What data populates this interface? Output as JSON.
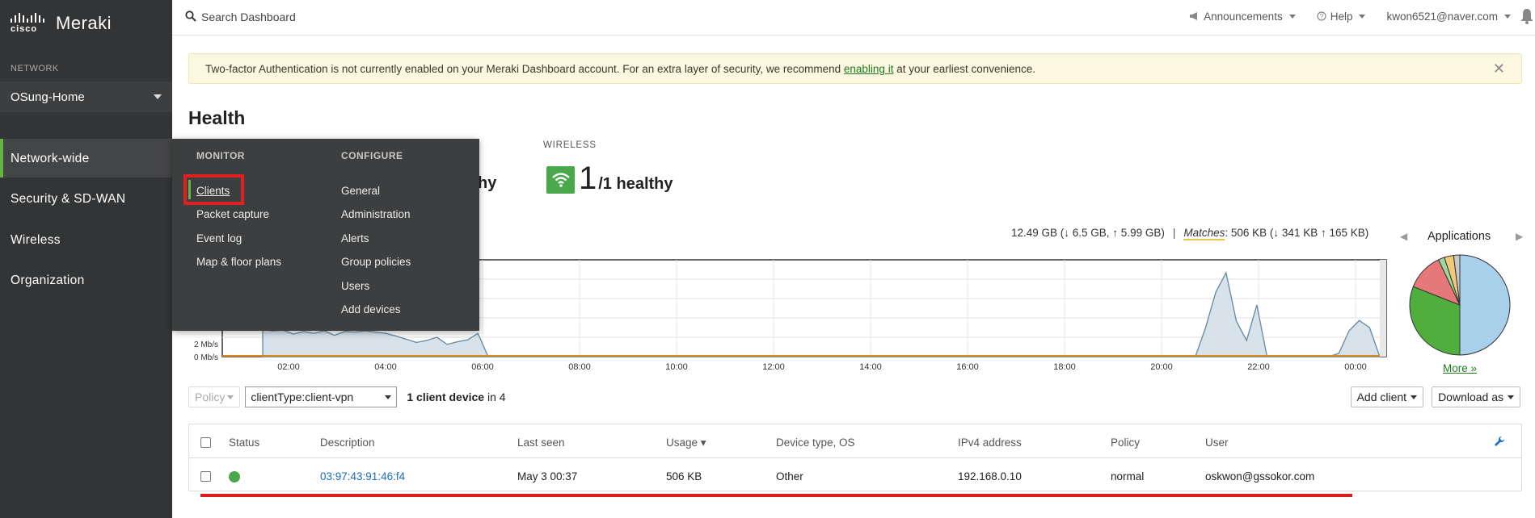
{
  "brand": {
    "cisco": "cisco",
    "meraki": "Meraki"
  },
  "sidebar": {
    "network_label": "NETWORK",
    "network_name": "OSung-Home",
    "items": [
      {
        "label": "Network-wide"
      },
      {
        "label": "Security & SD-WAN"
      },
      {
        "label": "Wireless"
      },
      {
        "label": "Organization"
      }
    ]
  },
  "topbar": {
    "search_placeholder": "Search Dashboard",
    "announcements": "Announcements",
    "help": "Help",
    "user": "kwon6521@naver.com"
  },
  "banner": {
    "text_before": "Two-factor Authentication is not currently enabled on your Meraki Dashboard account. For an extra layer of security, we recommend ",
    "link": "enabling it",
    "text_after": " at your earliest convenience.",
    "close": "✕"
  },
  "health": {
    "title": "Health",
    "wireless_label": "WIRELESS",
    "wireless_count": "1",
    "wireless_rest": "/1 healthy",
    "partial_hidden_text": "hy"
  },
  "usage": {
    "total": "12.49 GB (↓ 6.5 GB, ↑ 5.99 GB)",
    "matches_label": "Matches",
    "matches_value": ": 506 KB  (↓ 341 KB  ↑ 165 KB)"
  },
  "chart_data": {
    "type": "area",
    "x_ticks": [
      "02:00",
      "04:00",
      "06:00",
      "08:00",
      "10:00",
      "12:00",
      "14:00",
      "16:00",
      "18:00",
      "20:00",
      "22:00",
      "00:00"
    ],
    "y_ticks": [
      "0 Mb/s",
      "2 Mb/s"
    ],
    "series": [
      {
        "values": [
          4.2,
          4.0,
          4.1,
          3.5,
          3.9,
          3.6,
          4.0,
          3.3,
          3.9,
          3.8,
          4.0,
          3.8,
          3.6,
          3.2,
          2.7,
          2.2,
          2.5,
          3.0,
          1.9,
          2.3,
          2.6,
          3.6,
          0,
          0,
          0,
          0,
          0,
          0,
          0,
          0,
          0,
          0,
          0,
          0,
          0,
          0,
          0,
          0,
          0,
          0,
          0,
          0,
          0,
          0,
          0,
          0,
          0,
          0,
          0,
          0,
          0,
          0,
          0,
          0,
          0,
          0,
          0,
          0,
          0,
          0,
          0,
          0,
          0,
          0,
          0,
          0,
          0,
          0,
          0,
          0,
          0,
          0,
          0,
          0,
          0,
          0,
          0,
          0,
          0,
          0,
          0,
          0,
          0,
          0,
          0,
          0,
          0,
          0,
          0,
          0,
          0,
          0,
          4.5,
          10,
          13,
          5.5,
          2.5,
          8,
          0,
          0,
          0,
          0,
          0,
          0,
          0,
          0.5,
          4,
          5.6,
          4.5,
          0
        ]
      },
      {
        "values": [
          0,
          0,
          0,
          0,
          0,
          0,
          0,
          0,
          0,
          0,
          0,
          0
        ]
      }
    ],
    "applications_title": "Applications",
    "applications_pie": [
      {
        "value": 50,
        "color": "#a8d0ea"
      },
      {
        "value": 31,
        "color": "#4fae3c"
      },
      {
        "value": 12,
        "color": "#e6787a"
      },
      {
        "value": 2,
        "color": "#9fd69a"
      },
      {
        "value": 3,
        "color": "#f2c879"
      },
      {
        "value": 2,
        "color": "#c8c8c8"
      }
    ],
    "more_link": "More »"
  },
  "flyout": {
    "monitor_heading": "MONITOR",
    "configure_heading": "CONFIGURE",
    "monitor_items": [
      "Clients",
      "Packet capture",
      "Event log",
      "Map & floor plans"
    ],
    "configure_items": [
      "General",
      "Administration",
      "Alerts",
      "Group policies",
      "Users",
      "Add devices"
    ]
  },
  "controls": {
    "policy": "Policy",
    "filter_value": "clientType:client-vpn",
    "count_bold": "1 client device",
    "count_rest": " in 4",
    "add_client": "Add client",
    "download_as": "Download as"
  },
  "table": {
    "headers": [
      "Status",
      "Description",
      "Last seen",
      "Usage ▾",
      "Device type, OS",
      "IPv4 address",
      "Policy",
      "User"
    ],
    "rows": [
      {
        "description": "03:97:43:91:46:f4",
        "last_seen": "May 3 00:37",
        "usage": "506 KB",
        "device_type": "Other",
        "ipv4": "192.168.0.10",
        "policy": "normal",
        "user": "oskwon@gssokor.com"
      }
    ]
  },
  "colors": {
    "accent_green": "#67b346",
    "highlight_red": "#e02020",
    "link_blue": "#1a6bc2",
    "sidebar_bg": "#333435"
  }
}
